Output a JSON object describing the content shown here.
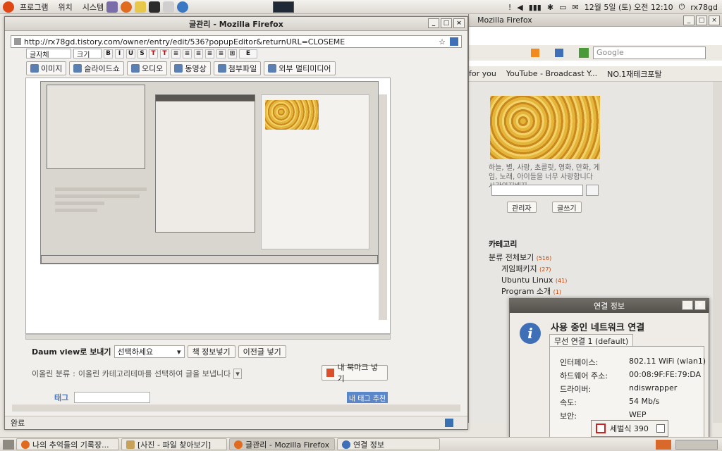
{
  "top_panel": {
    "menus": [
      "프로그램",
      "위치",
      "시스템"
    ],
    "clock": "12월  5일 (토) 오전 12:10",
    "user": "rx78gd"
  },
  "background_window": {
    "title": "Mozilla Firefox",
    "search_placeholder": "Google",
    "bookmarks": [
      "for you",
      "YouTube - Broadcast Y...",
      "NO.1재테크포탈"
    ],
    "blog": {
      "description": "하늘, 별, 사랑, 초콜릿, 영화, 만화, 게임, 노래, 아이들을 너무 사랑합니다 시간의지배자",
      "admin_button": "관리자",
      "write_button": "글쓰기",
      "category_heading": "카테고리",
      "categories": [
        {
          "label": "분류 전체보기",
          "count": "(516)"
        },
        {
          "label": "게임패키지",
          "count": "(27)"
        },
        {
          "label": "Ubuntu Linux",
          "count": "(41)"
        },
        {
          "label": "Program 소개",
          "count": "(1)"
        }
      ]
    }
  },
  "main_window": {
    "title": "글관리 - Mozilla Firefox",
    "url": "http://rx78gd.tistory.com/owner/entry/edit/536?popupEditor&returnURL=CLOSEME",
    "toolbar": {
      "font": "글자체",
      "size": "크기"
    },
    "media_buttons": [
      "이미지",
      "슬라이드쇼",
      "오디오",
      "동영상",
      "첨부파일",
      "외부 멀티미디어"
    ],
    "daum_view": {
      "label": "Daum view로 보내기",
      "select": "선택하세요",
      "btn1": "책 정보넣기",
      "btn2": "이전글 넣기"
    },
    "category_row": {
      "label": "이올린 분류",
      "hint": "이올린 카테고리테마를 선택하여 글을 보냅니다"
    },
    "bookmark_button": "내 북마크 넣기",
    "tag_label": "태그",
    "tag_recommend": "내 태그 추천",
    "status": "완료"
  },
  "connection_dialog": {
    "title": "연결 정보",
    "heading": "사용 중인 네트워크 연결",
    "tab": "무선 연결 1 (default)",
    "rows": [
      {
        "key": "인터페이스:",
        "value": "802.11 WiFi (wlan1)"
      },
      {
        "key": "하드웨어 주소:",
        "value": "00:08:9F:FE:79:DA"
      },
      {
        "key": "드라이버:",
        "value": "ndiswrapper"
      },
      {
        "key": "속도:",
        "value": "54 Mb/s"
      },
      {
        "key": "보안:",
        "value": "WEP"
      }
    ]
  },
  "tray_popup": {
    "label": "세벌식 390"
  },
  "taskbar": {
    "tasks": [
      "나의 추억들의 기록장...",
      "[사진 - 파일 찾아보기]",
      "글관리 - Mozilla Firefox",
      "연결 정보"
    ]
  }
}
